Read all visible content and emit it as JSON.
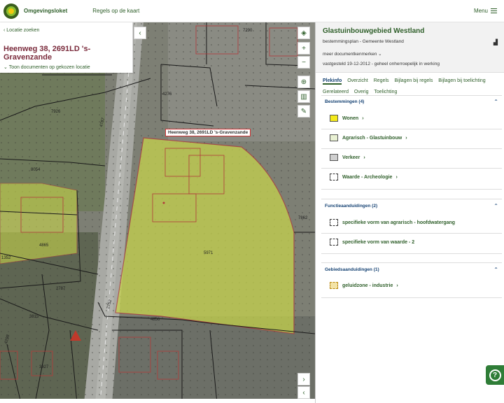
{
  "header": {
    "app_title": "Omgevingsloket",
    "nav_item": "Regels op de kaart",
    "menu_label": "Menu"
  },
  "search": {
    "back_label": "Locatie zoeken",
    "address": "Heenweg 38, 2691LD 's-Gravenzande",
    "toon_label": "Toon documenten op gekozen locatie"
  },
  "map": {
    "callout": "Heenweg 38, 2691LD 's-Gravenzande",
    "parcel_numbers": [
      "7290",
      "4276",
      "7926",
      "4787",
      "8054",
      "5971",
      "4865",
      "2787",
      "2752",
      "4856",
      "3815",
      "4298",
      "3327",
      "1352",
      "7862"
    ],
    "overlay_color": "#c8d64b",
    "boundary_color": "#b23a3a"
  },
  "panel": {
    "title": "Glastuinbouwgebied Westland",
    "subtitle": "bestemmingsplan - Gemeente Westland",
    "meer": "meer documentkenmerken",
    "status": "vastgesteld 19-12-2012 - geheel onherroepelijk in werking",
    "tabs": [
      "Plekinfo",
      "Overzicht",
      "Regels",
      "Bijlagen bij regels",
      "Bijlagen bij toelichting",
      "Gerelateerd",
      "Overig",
      "Toelichting"
    ],
    "sections": [
      {
        "title": "Bestemmingen (4)",
        "items": [
          {
            "label": "Wonen",
            "swatch": "#f4ea1b"
          },
          {
            "label": "Agrarisch - Glastuinbouw",
            "swatch": "#e9f1d3"
          },
          {
            "label": "Verkeer",
            "swatch": "#cfcfcf"
          },
          {
            "label": "Waarde - Archeologie",
            "swatch": "dashed"
          }
        ]
      },
      {
        "title": "Functieaanduidingen (2)",
        "items": [
          {
            "label": "specifieke vorm van agrarisch - hoofdwatergang",
            "swatch": "dashed"
          },
          {
            "label": "specifieke vorm van waarde - 2",
            "swatch": "dashed"
          }
        ]
      },
      {
        "title": "Gebiedsaanduidingen (1)",
        "items": [
          {
            "label": "geluidzone - industrie",
            "swatch": "#f3e3a6"
          }
        ]
      }
    ]
  },
  "icons": [
    "chevron-left-icon",
    "layers-icon",
    "zoom-in-icon",
    "zoom-out-icon",
    "locate-icon",
    "measure-icon",
    "draw-icon",
    "help-icon",
    "chart-icon"
  ]
}
